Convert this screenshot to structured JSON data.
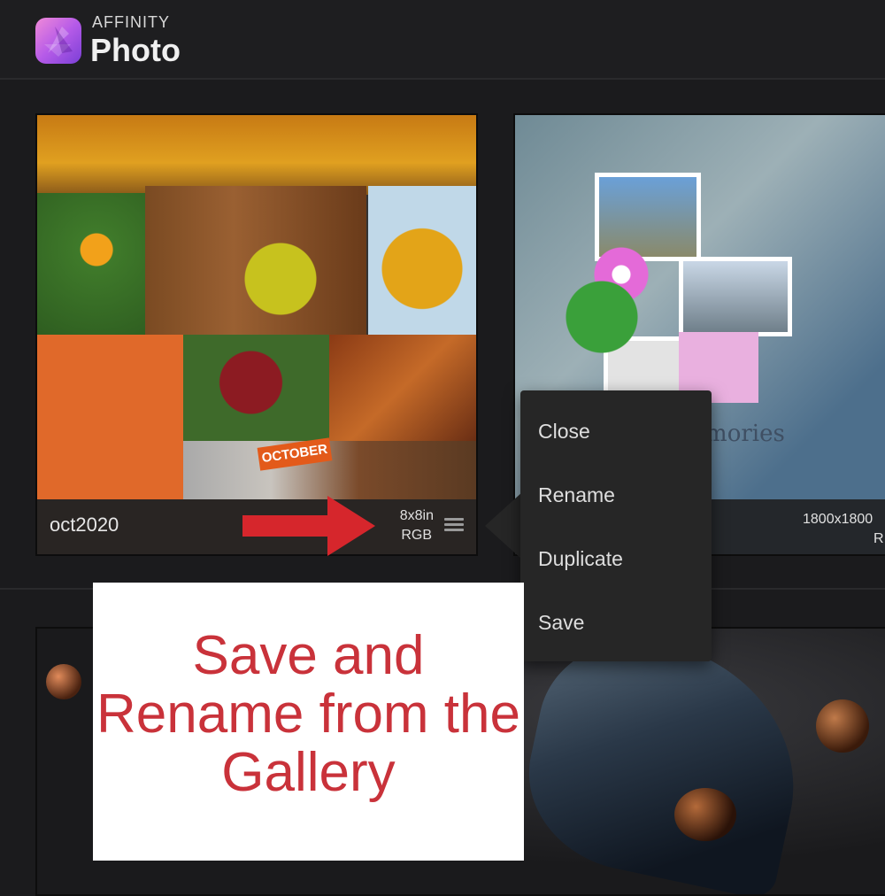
{
  "app": {
    "brand_top": "AFFINITY",
    "brand_name": "Photo",
    "icon": "affinity-photo-icon"
  },
  "gallery": {
    "documents": [
      {
        "name": "oct2020",
        "size": "8x8in",
        "mode": "RGB",
        "thumbnail_label": "OCTOBER"
      },
      {
        "name": "",
        "size": "1800x1800",
        "mode": "R",
        "thumbnail_label": "memories",
        "thumbnail_note": "journal card or photo"
      },
      {
        "name": "",
        "size": "",
        "mode": ""
      }
    ]
  },
  "context_menu": {
    "items": [
      "Close",
      "Rename",
      "Duplicate",
      "Save"
    ]
  },
  "annotation": {
    "text": "Save and Rename from the Gallery",
    "color": "#c9323a"
  }
}
